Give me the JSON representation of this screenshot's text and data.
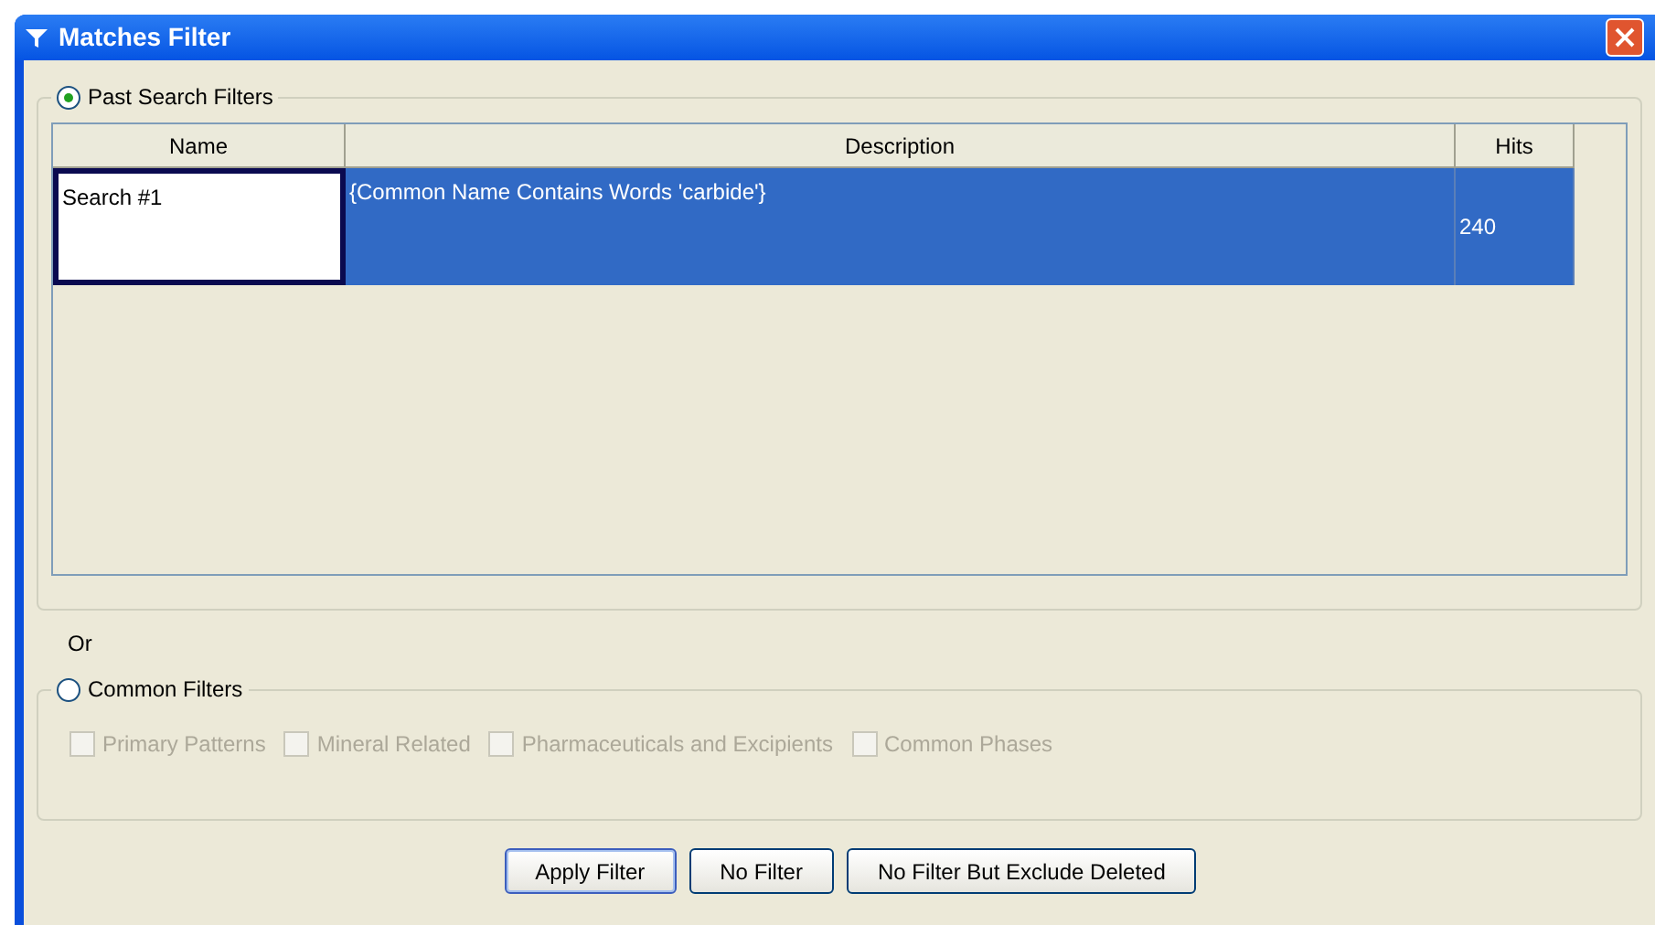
{
  "window": {
    "title": "Matches Filter"
  },
  "past_filters": {
    "label": "Past Search Filters",
    "selected": true,
    "table": {
      "columns": [
        "Name",
        "Description",
        "Hits"
      ],
      "rows": [
        {
          "selected": true,
          "cells": [
            {
              "text": "Search #1",
              "editing": true
            },
            {
              "text": "{Common Name Contains Words 'carbide'}",
              "editing": false
            },
            {
              "text": "240",
              "editing": false
            }
          ]
        }
      ]
    }
  },
  "separator": "Or",
  "common_filters": {
    "label": "Common Filters",
    "selected": false,
    "checkboxes": [
      {
        "label": "Primary Patterns",
        "checked": false,
        "disabled": true
      },
      {
        "label": "Mineral Related",
        "checked": false,
        "disabled": true
      },
      {
        "label": "Pharmaceuticals and Excipients",
        "checked": false,
        "disabled": true
      },
      {
        "label": "Common Phases",
        "checked": false,
        "disabled": true
      }
    ]
  },
  "buttons": [
    {
      "label": "Apply Filter",
      "default": true
    },
    {
      "label": "No Filter",
      "default": false
    },
    {
      "label": "No Filter But Exclude Deleted",
      "default": false
    }
  ]
}
